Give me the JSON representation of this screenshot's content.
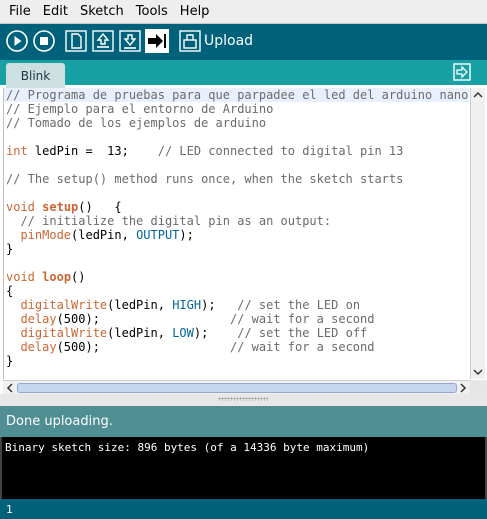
{
  "menu": [
    "File",
    "Edit",
    "Sketch",
    "Tools",
    "Help"
  ],
  "toolbar": {
    "upload_label": "Upload",
    "buttons": [
      "verify-icon",
      "stop-icon",
      "new-icon",
      "open-icon",
      "save-icon",
      "upload-icon",
      "serial-monitor-icon"
    ]
  },
  "tab": {
    "label": "Blink"
  },
  "editor": {
    "lines": [
      [
        [
          "c-com",
          "// Programa de pruebas para que parpadee el led del arduino nano"
        ]
      ],
      [
        [
          "c-com",
          "// Ejemplo para el entorno de Arduino"
        ]
      ],
      [
        [
          "c-com",
          "// Tomado de los ejemplos de arduino"
        ]
      ],
      [
        [
          "",
          ""
        ]
      ],
      [
        [
          "c-kw",
          "int"
        ],
        [
          "",
          " ledPin =  13;    "
        ],
        [
          "c-com",
          "// LED connected to digital pin 13"
        ]
      ],
      [
        [
          "",
          ""
        ]
      ],
      [
        [
          "c-com",
          "// The setup() method runs once, when the sketch starts"
        ]
      ],
      [
        [
          "",
          ""
        ]
      ],
      [
        [
          "c-kw",
          "void"
        ],
        [
          "",
          " "
        ],
        [
          "c-fnb",
          "setup"
        ],
        [
          "",
          "()   {"
        ]
      ],
      [
        [
          "c-com",
          "  // initialize the digital pin as an output:"
        ]
      ],
      [
        [
          "",
          "  "
        ],
        [
          "c-fn",
          "pinMode"
        ],
        [
          "",
          "(ledPin, "
        ],
        [
          "c-const",
          "OUTPUT"
        ],
        [
          "",
          ");"
        ]
      ],
      [
        [
          "",
          "}"
        ]
      ],
      [
        [
          "",
          ""
        ]
      ],
      [
        [
          "c-kw",
          "void"
        ],
        [
          "",
          " "
        ],
        [
          "c-fnb",
          "loop"
        ],
        [
          "",
          "()"
        ]
      ],
      [
        [
          "",
          "{"
        ]
      ],
      [
        [
          "",
          "  "
        ],
        [
          "c-fn",
          "digitalWrite"
        ],
        [
          "",
          "(ledPin, "
        ],
        [
          "c-const",
          "HIGH"
        ],
        [
          "",
          ");   "
        ],
        [
          "c-com",
          "// set the LED on"
        ]
      ],
      [
        [
          "",
          "  "
        ],
        [
          "c-fn",
          "delay"
        ],
        [
          "",
          "(500);                  "
        ],
        [
          "c-com",
          "// wait for a second"
        ]
      ],
      [
        [
          "",
          "  "
        ],
        [
          "c-fn",
          "digitalWrite"
        ],
        [
          "",
          "(ledPin, "
        ],
        [
          "c-const",
          "LOW"
        ],
        [
          "",
          ");    "
        ],
        [
          "c-com",
          "// set the LED off"
        ]
      ],
      [
        [
          "",
          "  "
        ],
        [
          "c-fn",
          "delay"
        ],
        [
          "",
          "(500);                  "
        ],
        [
          "c-com",
          "// wait for a second"
        ]
      ],
      [
        [
          "",
          "}"
        ]
      ]
    ]
  },
  "status": {
    "message": "Done uploading."
  },
  "console": {
    "text": "Binary sketch size: 896 bytes (of a 14336 byte maximum)"
  },
  "footer": {
    "line_number": "1"
  },
  "colors": {
    "toolbar": "#00627a",
    "tabbar": "#17a1a5",
    "status": "#4f8e93"
  }
}
